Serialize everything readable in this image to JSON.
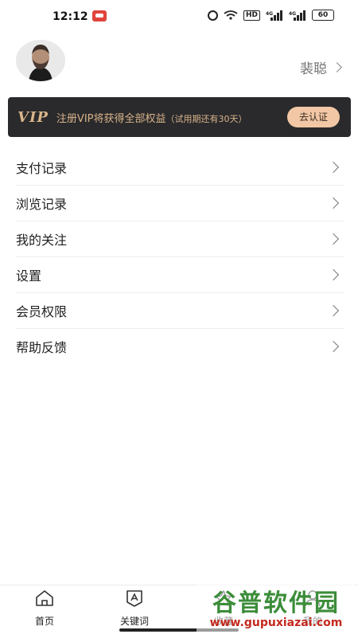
{
  "status_bar": {
    "time": "12:12",
    "hd": "HD",
    "battery": "60"
  },
  "profile": {
    "username": "裴聪"
  },
  "vip_banner": {
    "logo": "VIP",
    "text": "注册VIP将获得全部权益",
    "sub": "（试用期还有30天）",
    "button": "去认证"
  },
  "menu": {
    "items": [
      {
        "label": "支付记录"
      },
      {
        "label": "浏览记录"
      },
      {
        "label": "我的关注"
      },
      {
        "label": "设置"
      },
      {
        "label": "会员权限"
      },
      {
        "label": "帮助反馈"
      }
    ]
  },
  "bottom_nav": {
    "items": [
      {
        "label": "首页",
        "icon": "home-icon"
      },
      {
        "label": "关键词",
        "icon": "keyword-icon"
      },
      {
        "label": "收藏",
        "icon": "favorite-icon"
      },
      {
        "label": "我的",
        "icon": "profile-icon"
      }
    ]
  },
  "watermark": {
    "top": "谷普软件园",
    "bottom": "www.gupuxiazai.com"
  },
  "colors": {
    "vip_bg": "#2a2a2c",
    "vip_gold": "#d8b38a",
    "vip_button": "#f1c7a5"
  }
}
